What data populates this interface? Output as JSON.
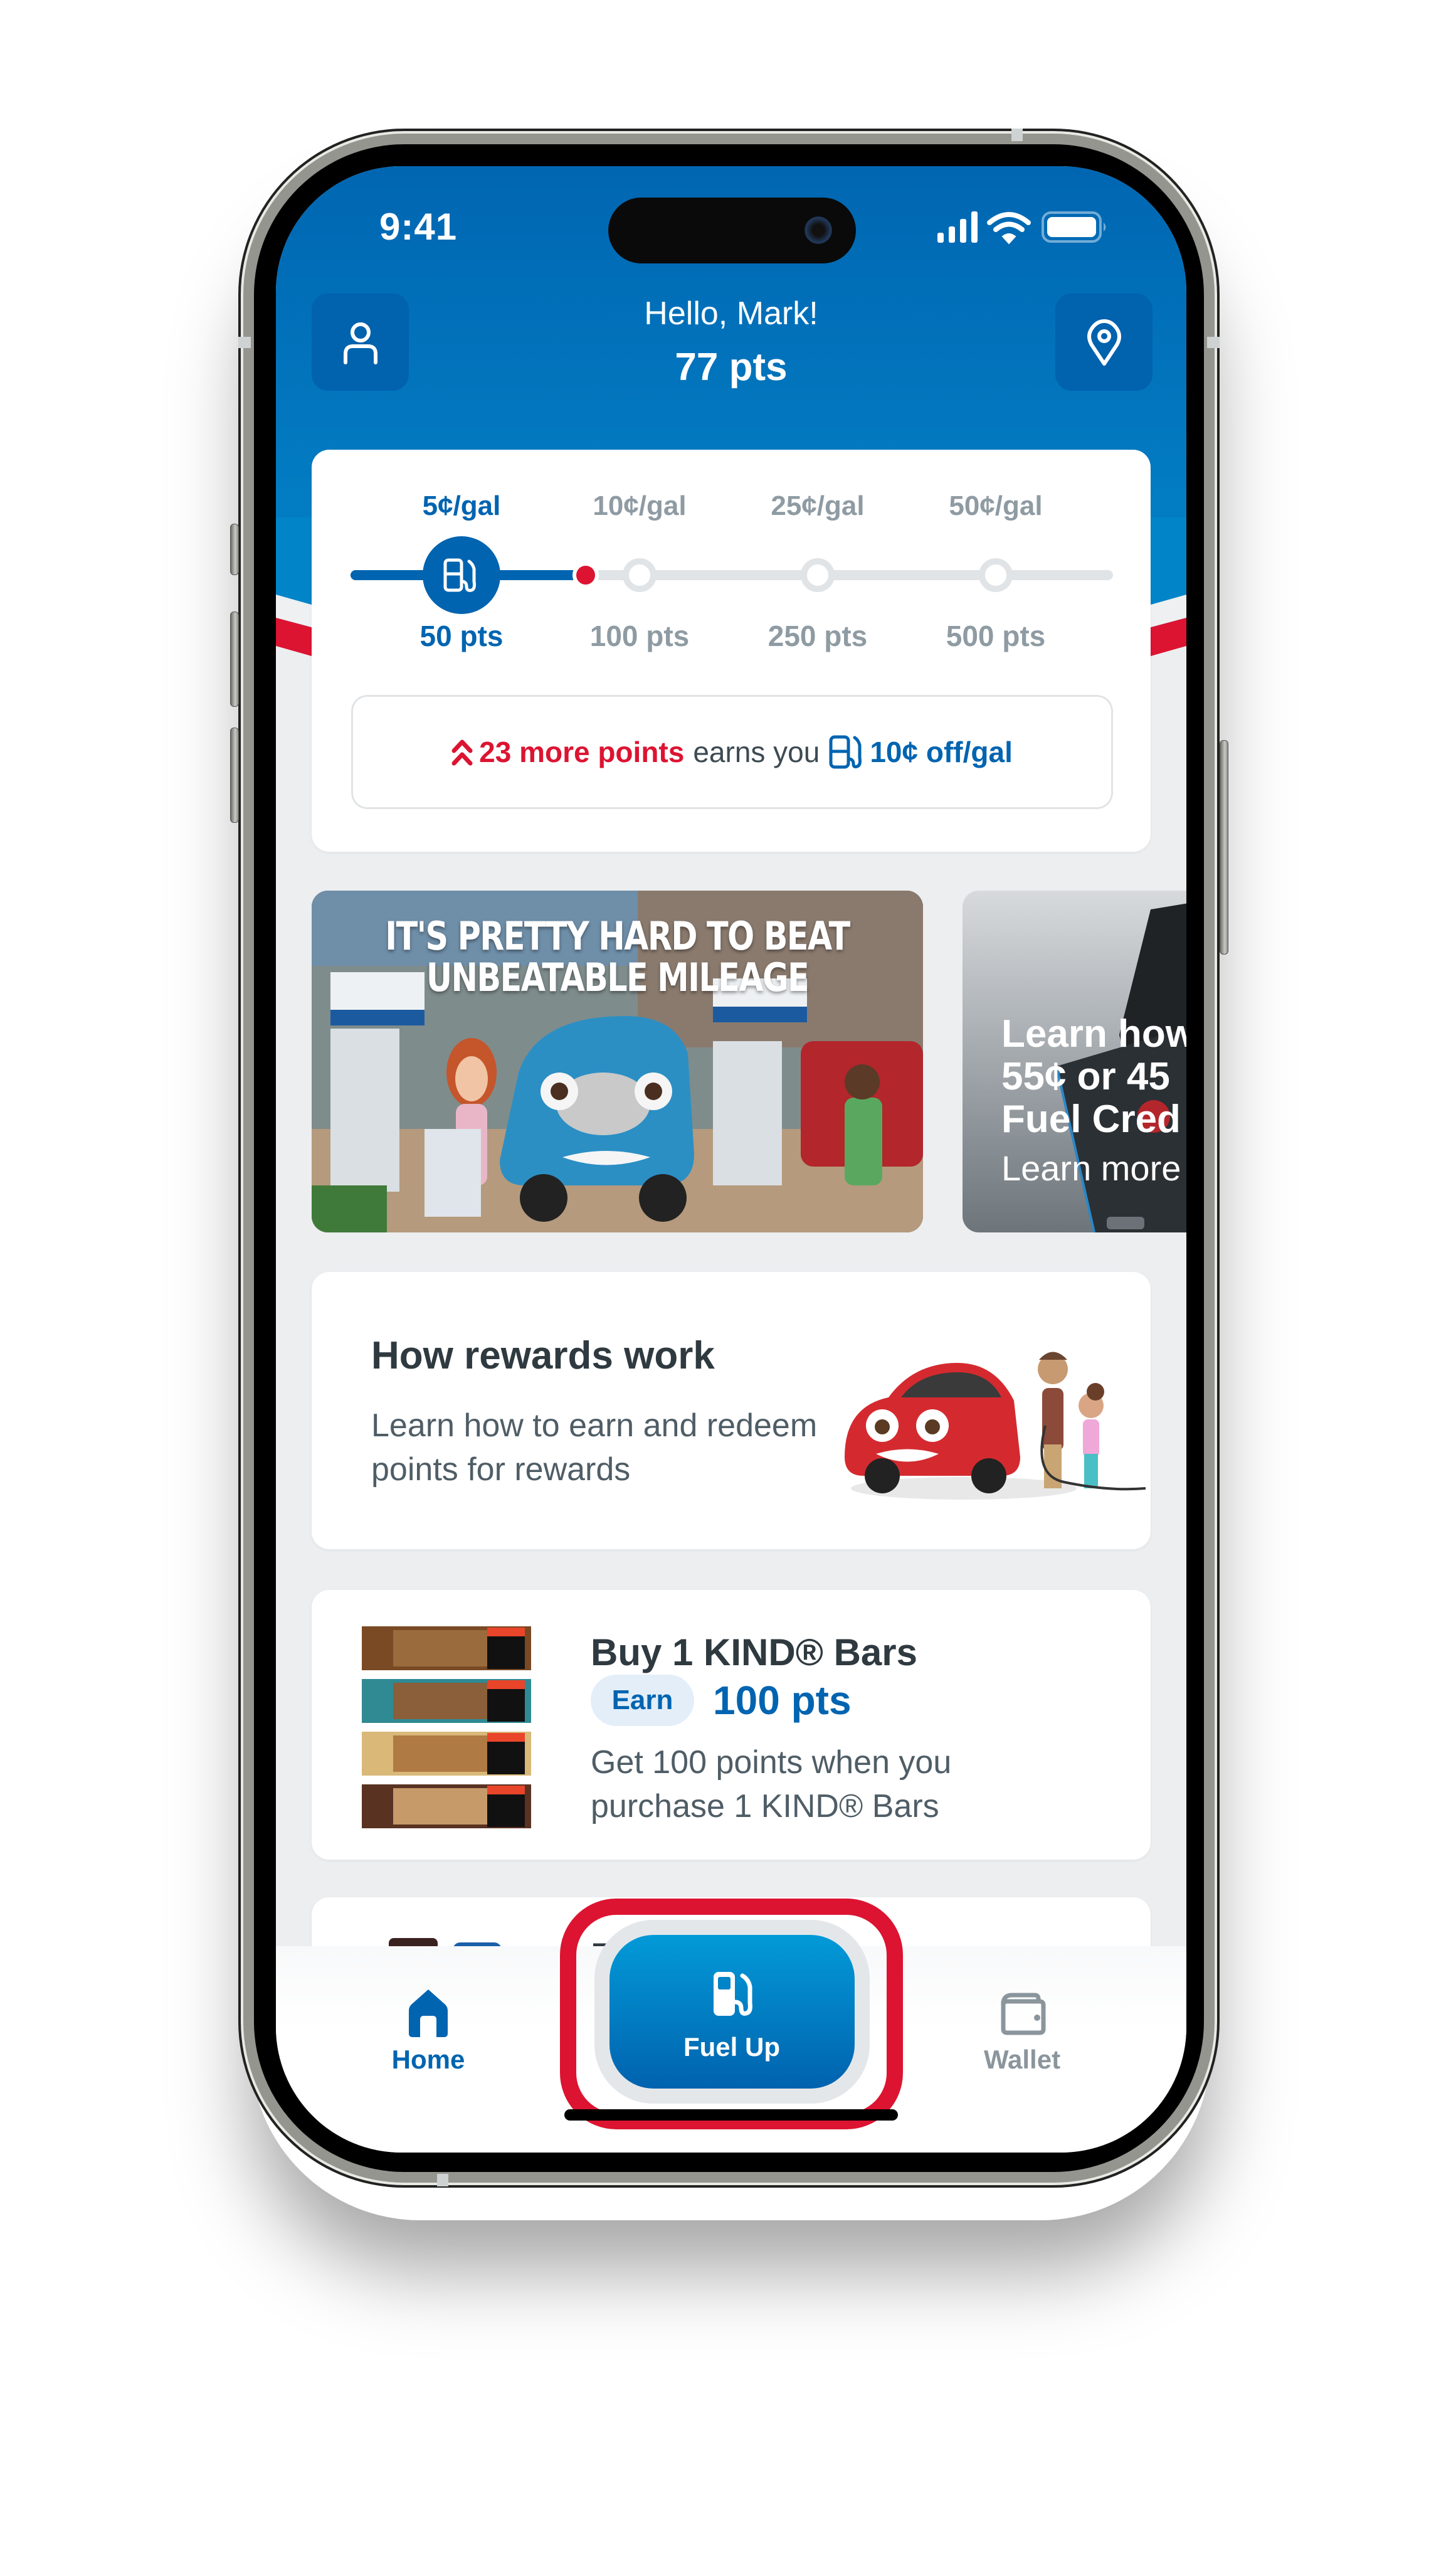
{
  "status_bar": {
    "time": "9:41",
    "icons": [
      "cellular-signal-icon",
      "wifi-icon",
      "battery-icon"
    ]
  },
  "header": {
    "greeting": "Hello, Mark!",
    "points": "77 pts",
    "left_button_icon": "profile-icon",
    "right_button_icon": "location-pin-icon"
  },
  "rewards_progress": {
    "current_points": 77,
    "tiers": [
      {
        "discount": "5¢/gal",
        "points": "50 pts",
        "achieved": true
      },
      {
        "discount": "10¢/gal",
        "points": "100 pts",
        "achieved": false
      },
      {
        "discount": "25¢/gal",
        "points": "250 pts",
        "achieved": false
      },
      {
        "discount": "50¢/gal",
        "points": "500 pts",
        "achieved": false
      }
    ],
    "message": {
      "highlight": "23 more points",
      "middle": "earns you",
      "reward": "10¢ off/gal"
    }
  },
  "promos": [
    {
      "title_line1": "IT'S PRETTY HARD TO BEAT",
      "title_line2": "UNBEATABLE MILEAGE"
    },
    {
      "line1": "Learn how",
      "line2": "55¢ or 45",
      "line3": "Fuel Cred",
      "link": "Learn more"
    }
  ],
  "how_rewards": {
    "title": "How rewards work",
    "description": "Learn how to earn and redeem points for rewards"
  },
  "offer": {
    "title": "Buy 1 KIND® Bars",
    "earn_label": "Earn",
    "earn_points": "100 pts",
    "description": "Get 100 points when you purchase 1 KIND® Bars"
  },
  "partial_card": {
    "heading_fragment": "B"
  },
  "tab_bar": {
    "home": "Home",
    "fuel_up": "Fuel Up",
    "wallet": "Wallet"
  },
  "colors": {
    "brand_blue": "#0064b0",
    "accent_red": "#dc1431",
    "inactive_gray": "#8f9ba3"
  }
}
